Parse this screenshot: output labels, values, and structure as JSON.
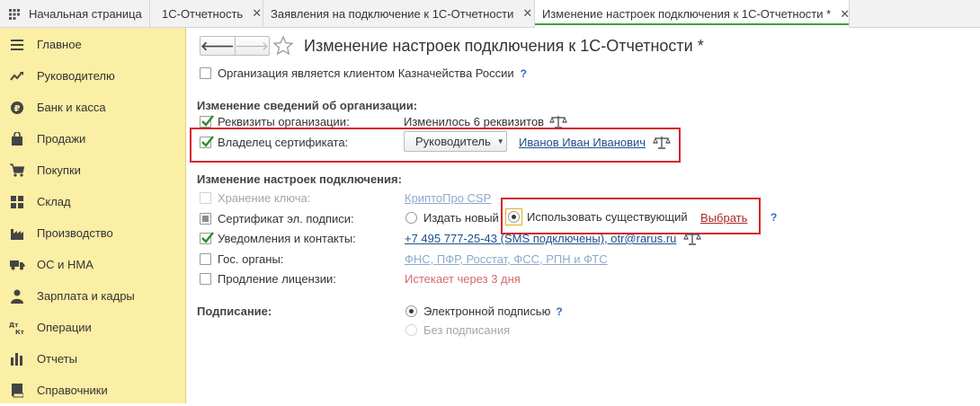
{
  "tabs": [
    {
      "label": "Начальная страница",
      "closable": false
    },
    {
      "label": "1С-Отчетность",
      "closable": true
    },
    {
      "label": "Заявления на подключение к 1С-Отчетности",
      "closable": true
    },
    {
      "label": "Изменение настроек подключения к 1С-Отчетности *",
      "closable": true,
      "active": true
    }
  ],
  "tab_close_glyph": "✕",
  "sidebar": {
    "items": [
      {
        "label": "Главное",
        "icon": "hamburger-icon"
      },
      {
        "label": "Руководителю",
        "icon": "trend-icon"
      },
      {
        "label": "Банк и касса",
        "icon": "ruble-icon"
      },
      {
        "label": "Продажи",
        "icon": "bag-icon"
      },
      {
        "label": "Покупки",
        "icon": "cart-icon"
      },
      {
        "label": "Склад",
        "icon": "warehouse-icon"
      },
      {
        "label": "Производство",
        "icon": "factory-icon"
      },
      {
        "label": "ОС и НМА",
        "icon": "truck-icon"
      },
      {
        "label": "Зарплата и кадры",
        "icon": "person-icon"
      },
      {
        "label": "Операции",
        "icon": "dt-kt-icon",
        "icon_text": "Дт Кт"
      },
      {
        "label": "Отчеты",
        "icon": "bar-chart-icon"
      },
      {
        "label": "Справочники",
        "icon": "book-icon"
      }
    ]
  },
  "nav": {
    "back": "🡐",
    "forward": "🡒"
  },
  "page": {
    "title": "Изменение настроек подключения к 1С-Отчетности *"
  },
  "treasury_checkbox": {
    "label": "Организация является клиентом Казначейства России",
    "checked": false
  },
  "help_mark": "?",
  "org_section": {
    "title": "Изменение сведений об организации:",
    "requisites": {
      "label": "Реквизиты организации:",
      "checked": true,
      "value": "Изменилось 6 реквизитов"
    },
    "owner": {
      "label": "Владелец сертификата:",
      "checked": true,
      "dropdown": "Руководитель",
      "person": "Иванов Иван Иванович"
    }
  },
  "conn_section": {
    "title": "Изменение настроек подключения:",
    "key_storage": {
      "label": "Хранение ключа:",
      "value": "КриптоПро CSP",
      "disabled": true
    },
    "signature_cert": {
      "label": "Сертификат эл. подписи:",
      "option_new": "Издать новый",
      "option_existing": "Использовать существующий",
      "selected": "existing",
      "choose_link": "Выбрать"
    },
    "notifications": {
      "label": "Уведомления и контакты:",
      "checked": true,
      "value": "+7 495 777-25-43 (SMS подключены), otr@rarus.ru"
    },
    "gov_bodies": {
      "label": "Гос. органы:",
      "checked": false,
      "value": "ФНС, ПФР, Росстат, ФСС, РПН и ФТС"
    },
    "license": {
      "label": "Продление лицензии:",
      "checked": false,
      "value": "Истекает через 3 дня"
    }
  },
  "signing": {
    "title": "Подписание:",
    "option_electronic": "Электронной подписью",
    "option_none": "Без подписания",
    "selected": "electronic"
  },
  "colors": {
    "sidebar_bg": "#fbeea5",
    "highlight": "#d3272c",
    "link": "#1f4e8a",
    "active_tab_line": "#3aa33a",
    "warning": "#d46b6b"
  }
}
